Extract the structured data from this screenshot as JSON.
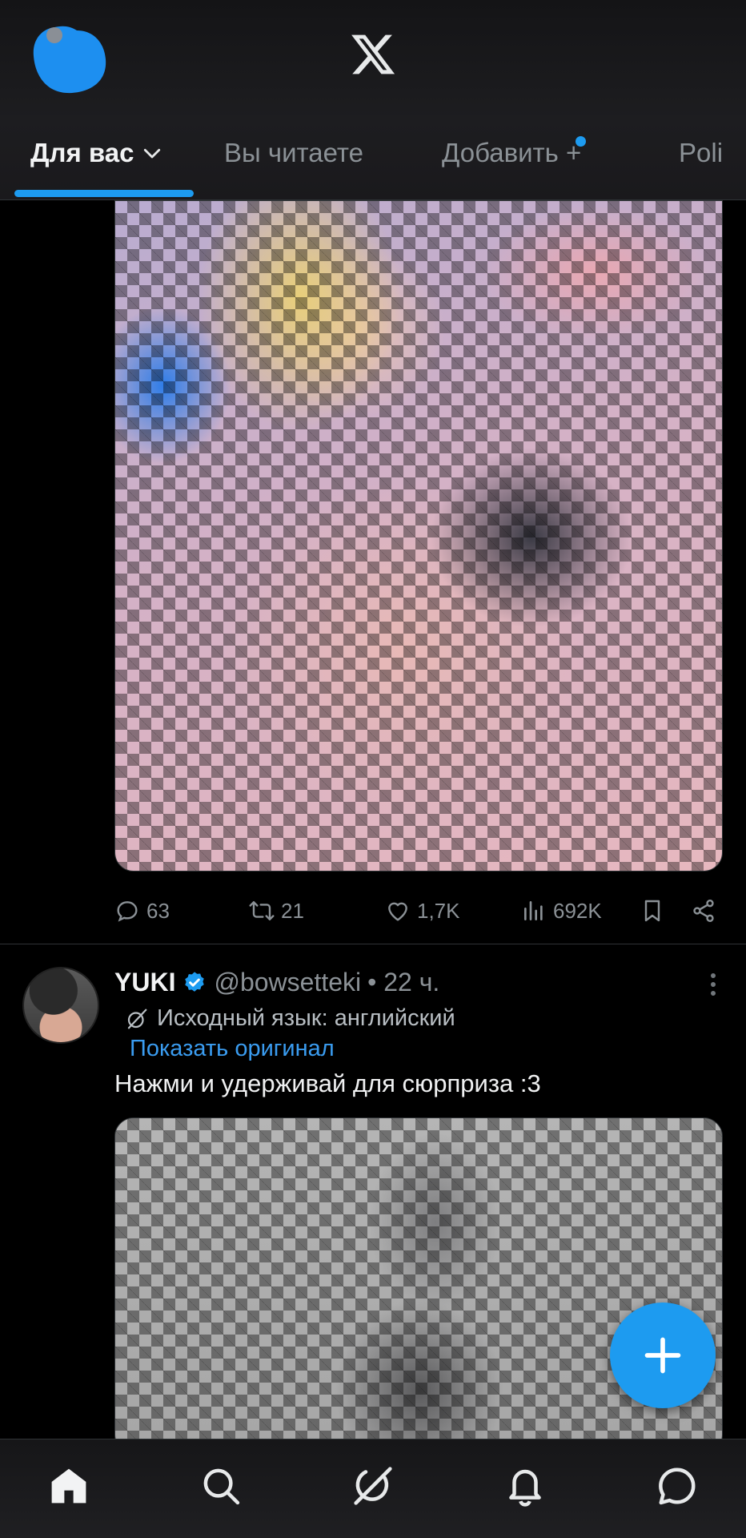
{
  "header": {
    "logo": "x-logo",
    "tabs": [
      {
        "label": "Для вас",
        "active": true,
        "has_dropdown": true
      },
      {
        "label": "Вы читаете",
        "active": false
      },
      {
        "label": "Добавить +",
        "active": false,
        "has_dot": true
      },
      {
        "label": "Poli",
        "active": false
      }
    ]
  },
  "feed": {
    "post1": {
      "actions": {
        "replies": "63",
        "reposts": "21",
        "likes": "1,7K",
        "views": "692K"
      }
    },
    "post2": {
      "name": "YUKI",
      "verified": true,
      "handle": "@bowsetteki",
      "time": "• 22 ч.",
      "translation_note": "Исходный язык: английский",
      "show_original": "Показать оригинал",
      "text": "Нажми и удерживай для сюрприза :3"
    }
  },
  "fab": {
    "icon": "plus-icon"
  },
  "bottom_nav": [
    {
      "icon": "home-icon",
      "active": true
    },
    {
      "icon": "search-icon"
    },
    {
      "icon": "grok-icon"
    },
    {
      "icon": "bell-icon"
    },
    {
      "icon": "messages-icon"
    }
  ],
  "colors": {
    "accent": "#1d9bf0",
    "background": "#000000",
    "muted_text": "#8b9196"
  }
}
